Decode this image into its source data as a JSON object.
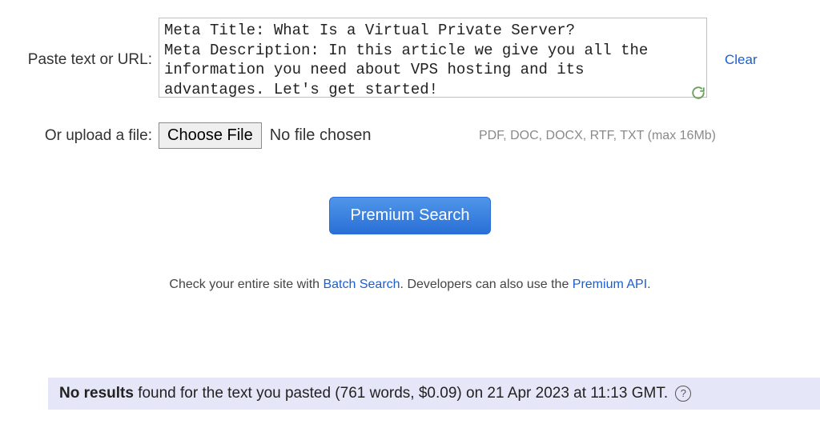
{
  "input": {
    "paste_label": "Paste text or URL:",
    "textarea_value": "Meta Title: What Is a Virtual Private Server?\nMeta Description: In this article we give you all the information you need about VPS hosting and its advantages. Let's get started!",
    "clear_label": "Clear"
  },
  "upload": {
    "label": "Or upload a file:",
    "button_label": "Choose File",
    "status_text": "No file chosen",
    "hint_text": "PDF, DOC, DOCX, RTF, TXT (max 16Mb)"
  },
  "premium": {
    "button_label": "Premium Search"
  },
  "notice": {
    "prefix": "Check your entire site with ",
    "batch_link": "Batch Search",
    "middle": ". Developers can also use the ",
    "api_link": "Premium API",
    "suffix": "."
  },
  "results": {
    "bold_lead": "No results",
    "rest": " found for the text you pasted (761 words, $0.09) on 21 Apr 2023 at 11:13 GMT. ",
    "help_glyph": "?"
  }
}
